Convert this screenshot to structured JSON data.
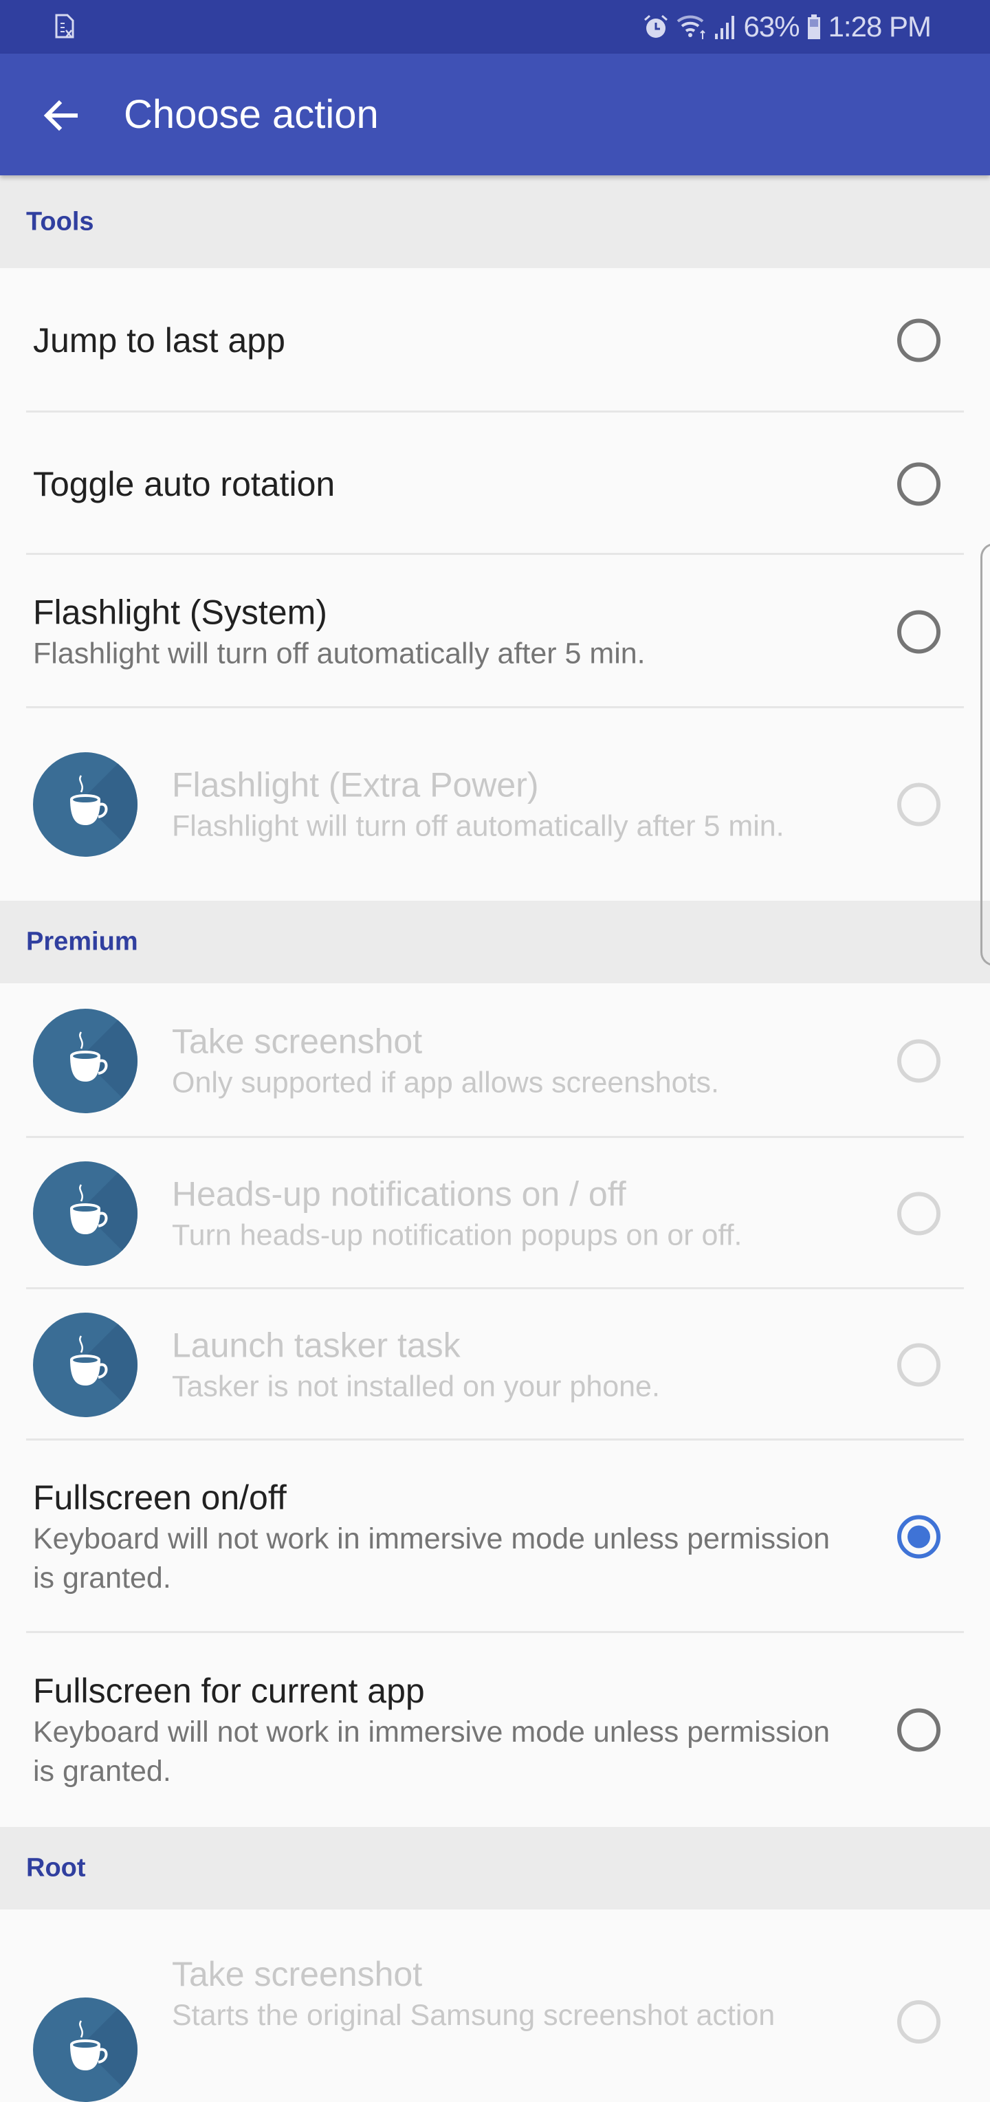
{
  "status_bar": {
    "left_icon": "sim-card-error-icon",
    "icons": [
      "alarm-icon",
      "wifi-icon",
      "signal-icon"
    ],
    "battery_percent": "63%",
    "battery_icon": "battery-icon",
    "time": "1:28 PM"
  },
  "app_bar": {
    "back_icon": "arrow-back-icon",
    "title": "Choose action"
  },
  "colors": {
    "status_bar": "#303f9f",
    "app_bar": "#3f51b5",
    "section_title": "#303f9f",
    "radio_checked": "#3f73d6",
    "premium_icon": "#3a6d95"
  },
  "sections": [
    {
      "title": "Tools",
      "items": [
        {
          "title": "Jump to last app",
          "subtitle": "",
          "enabled": true,
          "selected": false,
          "icon": ""
        },
        {
          "title": "Toggle auto rotation",
          "subtitle": "",
          "enabled": true,
          "selected": false,
          "icon": ""
        },
        {
          "title": "Flashlight (System)",
          "subtitle": "Flashlight will turn off automatically after 5 min.",
          "enabled": true,
          "selected": false,
          "icon": ""
        },
        {
          "title": "Flashlight (Extra Power)",
          "subtitle": "Flashlight will turn off automatically after 5 min.",
          "enabled": false,
          "selected": false,
          "icon": "coffee-cup-icon"
        }
      ]
    },
    {
      "title": "Premium",
      "items": [
        {
          "title": "Take screenshot",
          "subtitle": "Only supported if app allows screenshots.",
          "enabled": false,
          "selected": false,
          "icon": "coffee-cup-icon"
        },
        {
          "title": "Heads-up notifications on / off",
          "subtitle": "Turn heads-up notification popups on or off.",
          "enabled": false,
          "selected": false,
          "icon": "coffee-cup-icon"
        },
        {
          "title": "Launch tasker task",
          "subtitle": "Tasker is not installed on your phone.",
          "enabled": false,
          "selected": false,
          "icon": "coffee-cup-icon"
        },
        {
          "title": "Fullscreen on/off",
          "subtitle": "Keyboard will not work in immersive mode unless permission is granted.",
          "enabled": true,
          "selected": true,
          "icon": ""
        },
        {
          "title": "Fullscreen for current app",
          "subtitle": "Keyboard will not work in immersive mode unless permission is granted.",
          "enabled": true,
          "selected": false,
          "icon": ""
        }
      ]
    },
    {
      "title": "Root",
      "items": [
        {
          "title": "Take screenshot",
          "subtitle": "Starts the original Samsung screenshot action",
          "enabled": false,
          "selected": false,
          "icon": "coffee-cup-icon"
        }
      ]
    }
  ]
}
